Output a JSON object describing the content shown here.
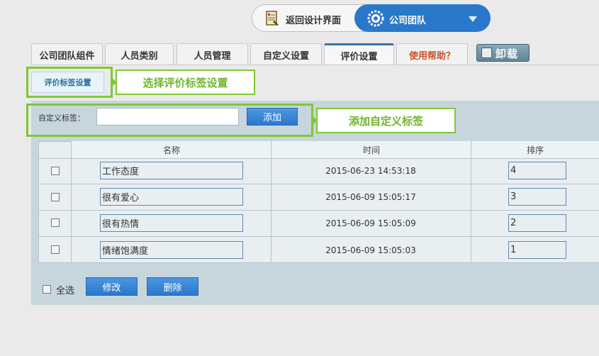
{
  "header": {
    "back_label": "返回设计界面",
    "team_label": "公司团队"
  },
  "tabs": [
    {
      "label": "公司团队组件"
    },
    {
      "label": "人员类别"
    },
    {
      "label": "人员管理"
    },
    {
      "label": "自定义设置"
    },
    {
      "label": "评价设置"
    },
    {
      "label": "使用帮助？"
    }
  ],
  "unload_label": "卸载",
  "subnav": {
    "button_label": "评价标签设置",
    "callout": "选择评价标签设置"
  },
  "form": {
    "label": "自定义标签：",
    "input_value": "",
    "add_label": "添加",
    "callout": "添加自定义标签"
  },
  "table": {
    "headers": [
      "名称",
      "时间",
      "排序"
    ],
    "rows": [
      {
        "name": "工作态度",
        "time": "2015-06-23 14:53:18",
        "order": "4"
      },
      {
        "name": "很有爱心",
        "time": "2015-06-09 15:05:17",
        "order": "3"
      },
      {
        "name": "很有热情",
        "time": "2015-06-09 15:05:09",
        "order": "2"
      },
      {
        "name": "情绪饱满度",
        "time": "2015-06-09 15:05:03",
        "order": "1"
      }
    ]
  },
  "footer": {
    "select_all_label": "全选",
    "edit_label": "修改",
    "delete_label": "删除"
  },
  "colors": {
    "accent_blue": "#2a78c9",
    "highlight_green": "#7ec832",
    "panel_bg": "#c7d6dd",
    "help_orange": "#c8512a"
  }
}
